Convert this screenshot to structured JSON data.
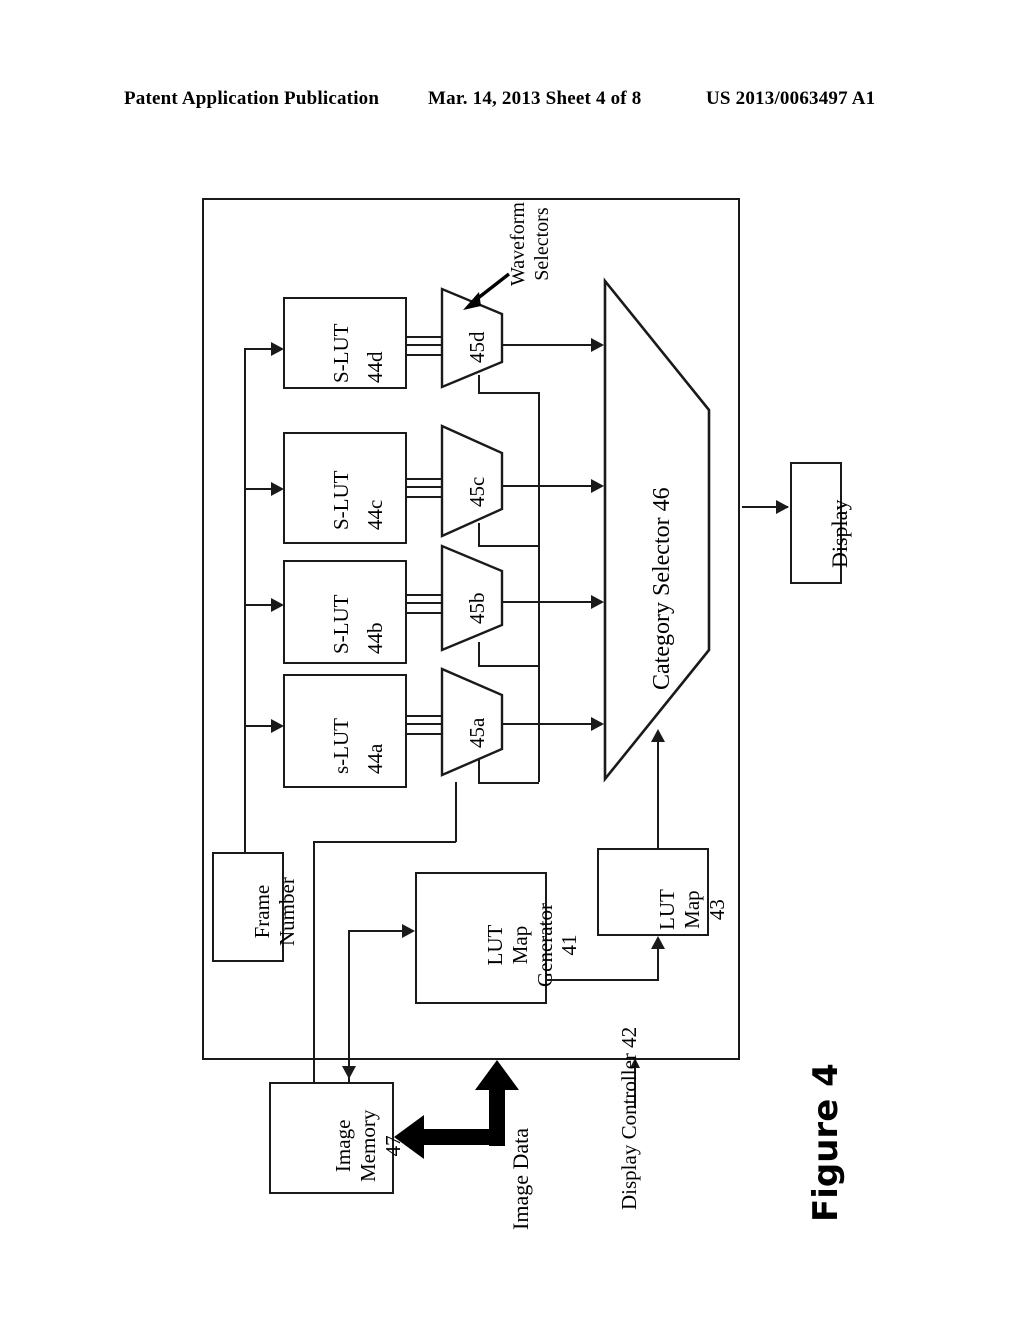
{
  "header": {
    "publication": "Patent Application Publication",
    "date_sheet": "Mar. 14, 2013  Sheet 4 of 8",
    "patent_number": "US 2013/0063497 A1"
  },
  "figure": {
    "caption": "Figure 4",
    "outer_block_label": "Display Controller 42",
    "annotations": {
      "waveform_selectors": "Waveform\nSelectors",
      "image_data": "Image Data"
    },
    "slut_blocks": [
      {
        "name": "S-LUT",
        "ref": "44d"
      },
      {
        "name": "S-LUT",
        "ref": "44c"
      },
      {
        "name": "S-LUT",
        "ref": "44b"
      },
      {
        "name": "s-LUT",
        "ref": "44a"
      }
    ],
    "waveform_selectors": [
      {
        "ref": "45d"
      },
      {
        "ref": "45c"
      },
      {
        "ref": "45b"
      },
      {
        "ref": "45a"
      }
    ],
    "category_selector": "Category Selector 46",
    "display_block": "Display",
    "frame_number_block": "Frame\nNumber",
    "lut_map_generator_block": "LUT\nMap\nGenerator\n41",
    "lut_map_block": "LUT\nMap\n43",
    "image_memory_block": "Image\nMemory\n47"
  },
  "colors": {
    "ink": "#1a1a1a",
    "paper": "#ffffff"
  }
}
